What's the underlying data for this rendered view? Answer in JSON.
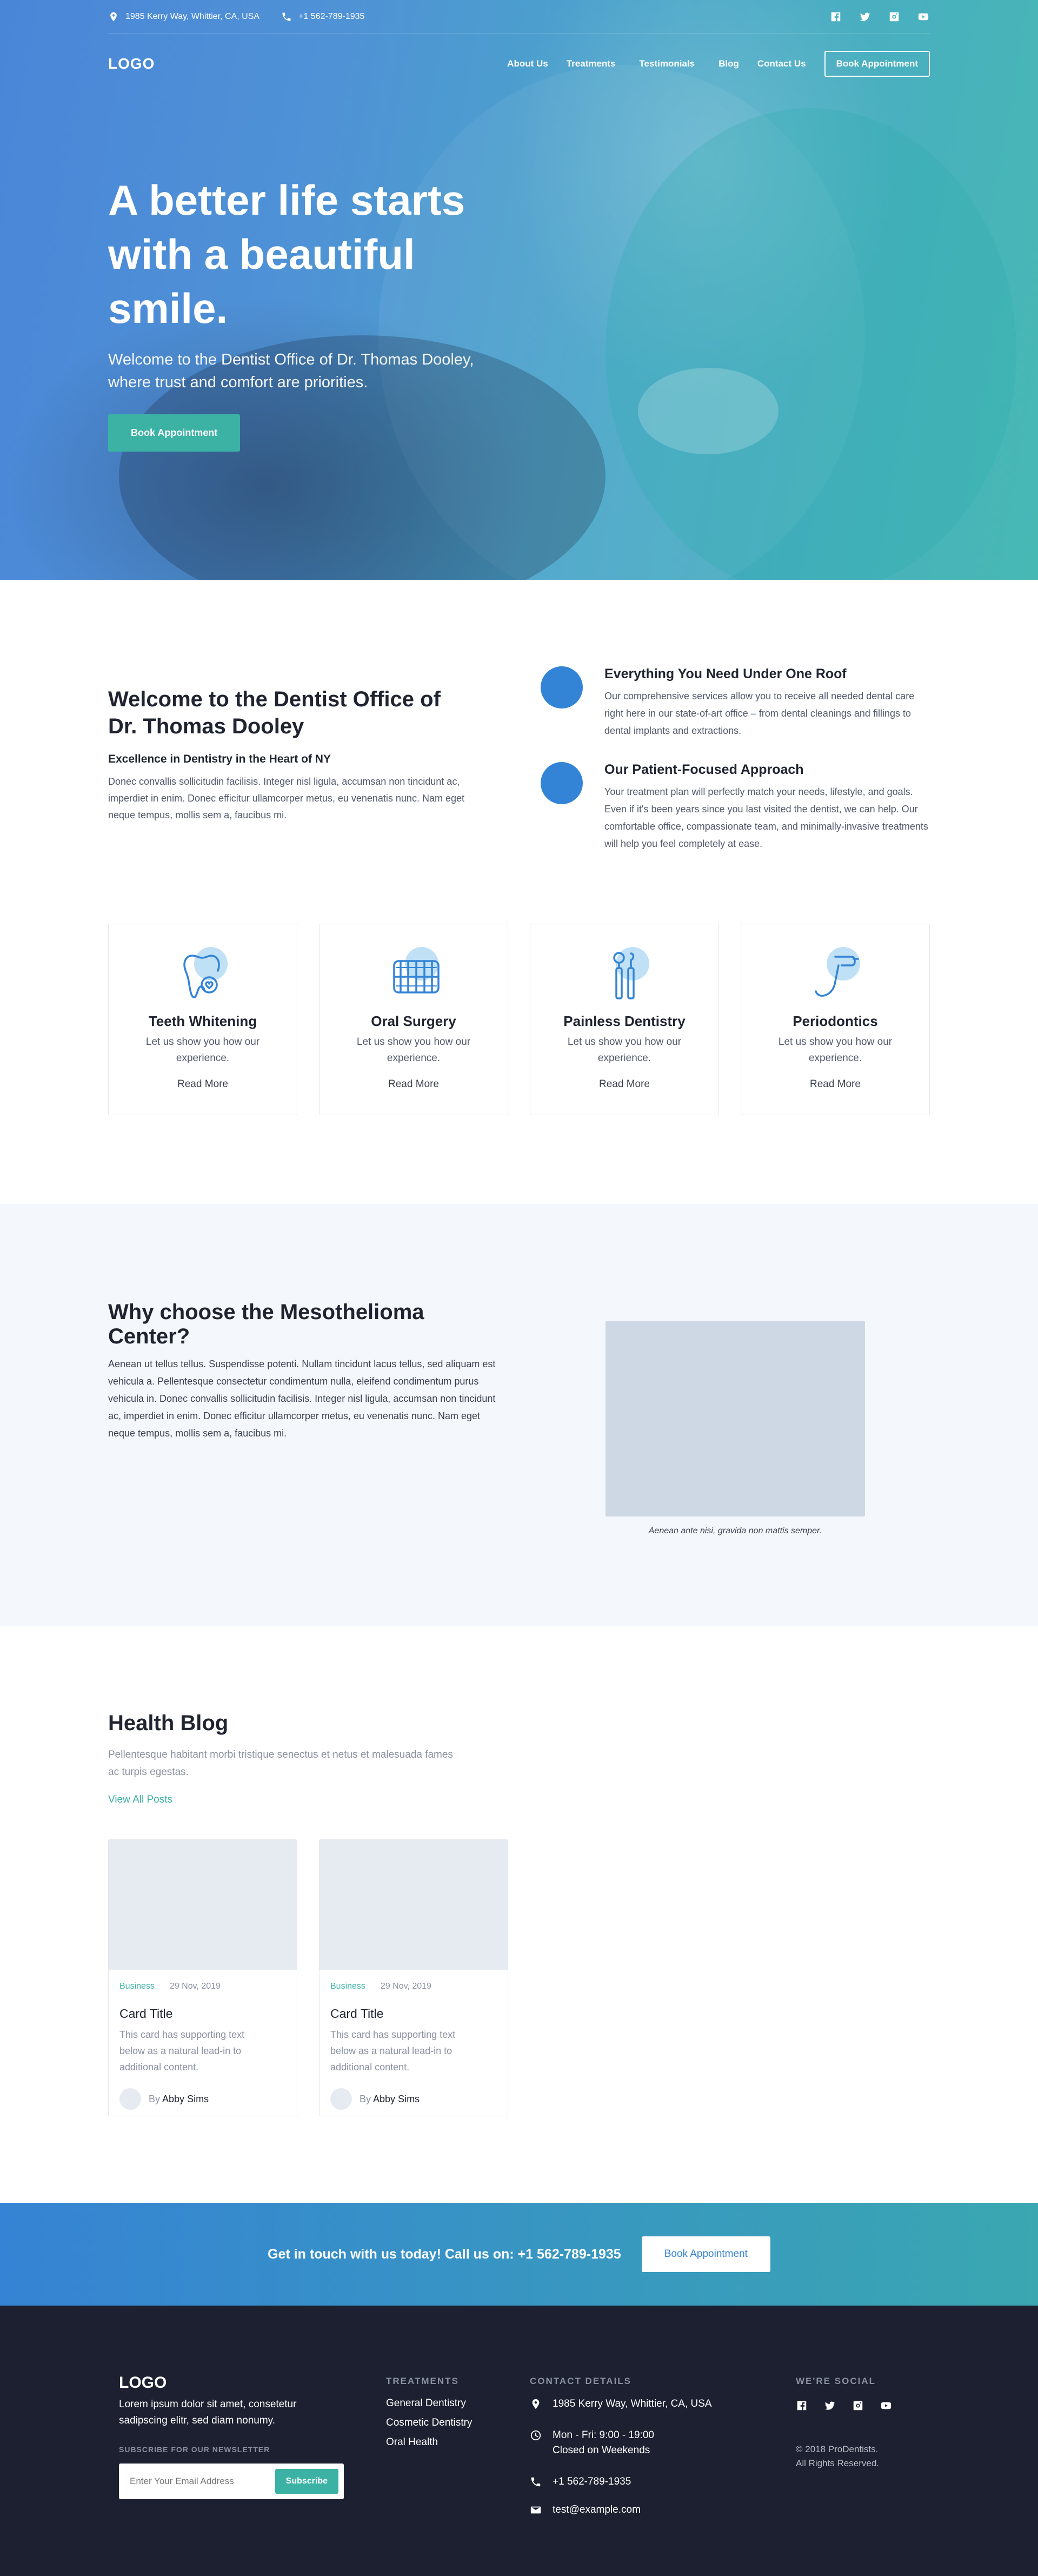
{
  "topbar": {
    "address": "1985 Kerry Way, Whittier, CA, USA",
    "phone": "+1 562-789-1935",
    "social_icons": [
      "facebook-icon",
      "twitter-icon",
      "instagram-icon",
      "youtube-icon"
    ]
  },
  "nav": {
    "logo": "LOGO",
    "items": [
      "About Us",
      "Treatments",
      "Testimonials",
      "Blog",
      "Contact Us"
    ],
    "cta": "Book Appointment"
  },
  "hero": {
    "title": "A better life starts with a beautiful smile.",
    "subtitle": "Welcome to the Dentist Office of Dr. Thomas Dooley, where trust and comfort are priorities.",
    "button": "Book Appointment"
  },
  "welcome": {
    "title": "Welcome to the Dentist Office of Dr. Thomas Dooley",
    "subtitle": "Excellence in Dentistry in the Heart of NY",
    "text": "Donec convallis sollicitudin facilisis. Integer nisl ligula, accumsan non tincidunt ac, imperdiet in enim. Donec efficitur ullamcorper metus, eu venenatis nunc. Nam eget neque tempus, mollis sem a, faucibus mi.",
    "features": [
      {
        "title": "Everything You Need Under One Roof",
        "text": "Our comprehensive services allow you to receive all needed dental care right here in our state-of-art office – from dental cleanings and fillings to dental implants and extractions."
      },
      {
        "title": "Our Patient-Focused Approach",
        "text": "Your treatment plan will perfectly match your needs, lifestyle, and goals. Even if it's been years since you last visited the dentist, we can help. Our comfortable office, compassionate team, and minimally-invasive treatments will help you feel completely at ease."
      }
    ]
  },
  "services": [
    {
      "icon": "tooth-icon",
      "title": "Teeth Whitening",
      "text": "Let us show you how our experience.",
      "link": "Read More"
    },
    {
      "icon": "teeth-icon",
      "title": "Oral Surgery",
      "text": "Let us show you how our experience.",
      "link": "Read More"
    },
    {
      "icon": "dental-tools-icon",
      "title": "Painless Dentistry",
      "text": "Let us show you how our experience.",
      "link": "Read More"
    },
    {
      "icon": "dental-drill-icon",
      "title": "Periodontics",
      "text": "Let us show you how our experience.",
      "link": "Read More"
    }
  ],
  "why": {
    "title": "Why choose the Mesothelioma Center?",
    "text": "Aenean ut tellus tellus. Suspendisse potenti. Nullam tincidunt lacus tellus, sed aliquam est vehicula a. Pellentesque consectetur condimentum nulla, eleifend condimentum purus vehicula in. Donec convallis sollicitudin facilisis. Integer nisl ligula, accumsan non tincidunt ac, imperdiet in enim. Donec efficitur ullamcorper metus, eu venenatis nunc. Nam eget neque tempus, mollis sem a, faucibus mi.",
    "caption": "Aenean ante nisi, gravida non mattis semper."
  },
  "blog": {
    "title": "Health Blog",
    "subtitle": "Pellentesque habitant morbi tristique senectus et netus et malesuada fames ac turpis egestas.",
    "view_all": "View All Posts",
    "posts": [
      {
        "tag": "Business",
        "date": "29 Nov, 2019",
        "title": "Card Title",
        "text": "This card has supporting text below as a natural lead-in to additional content.",
        "by": "By",
        "author": "Abby Sims"
      },
      {
        "tag": "Business",
        "date": "29 Nov, 2019",
        "title": "Card Title",
        "text": "This card has supporting text below as a natural lead-in to additional content.",
        "by": "By",
        "author": "Abby Sims"
      }
    ]
  },
  "cta": {
    "text": "Get in touch with us today! Call us on: +1 562-789-1935",
    "button": "Book Appointment"
  },
  "footer": {
    "logo": "LOGO",
    "text": "Lorem ipsum dolor sit amet, consetetur sadipscing elitr, sed diam nonumy.",
    "newsletter_label": "SUBSCRIBE FOR OUR NEWSLETTER",
    "newsletter_placeholder": "Enter Your Email Address",
    "subscribe": "Subscribe",
    "treatments_title": "TREATMENTS",
    "treatments": [
      "General Dentistry",
      "Cosmetic Dentistry",
      "Oral Health"
    ],
    "contact_title": "CONTACT DETAILS",
    "address": "1985 Kerry Way, Whittier, CA, USA",
    "hours_1": "Mon - Fri: 9:00 - 19:00",
    "hours_2": "Closed on Weekends",
    "phone": "+1 562-789-1935",
    "email": "test@example.com",
    "social_title": "WE'RE SOCIAL",
    "copyright_1": "© 2018 ProDentists.",
    "copyright_2": "All Rights Reserved."
  }
}
